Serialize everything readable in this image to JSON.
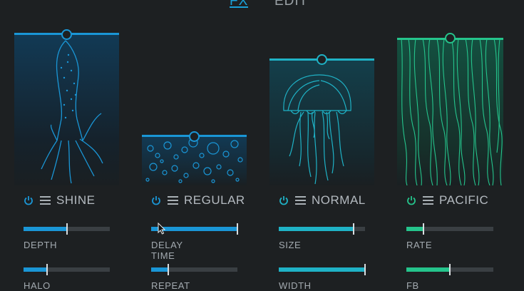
{
  "tabs": [
    {
      "label": "FX",
      "active": true
    },
    {
      "label": "EDIT",
      "active": false
    }
  ],
  "modules": [
    {
      "id": "squid",
      "illustration": "squid-icon",
      "accent": "#1a96d6",
      "preset": "SHINE",
      "params": [
        {
          "label": "DEPTH",
          "value": 0.5
        },
        {
          "label": "HALO",
          "value": 0.27
        }
      ]
    },
    {
      "id": "bubbles",
      "illustration": "bubbles-icon",
      "accent": "#1a96d6",
      "preset": "REGULAR",
      "params": [
        {
          "label": "DELAY TIME",
          "value": 1.0
        },
        {
          "label": "REPEAT",
          "value": 0.2
        }
      ]
    },
    {
      "id": "jellyfish",
      "illustration": "jellyfish-icon",
      "accent": "#1fb2c6",
      "preset": "NORMAL",
      "params": [
        {
          "label": "SIZE",
          "value": 0.87
        },
        {
          "label": "WIDTH",
          "value": 1.0
        }
      ]
    },
    {
      "id": "seaweed",
      "illustration": "seaweed-icon",
      "accent": "#25c48c",
      "preset": "PACIFIC",
      "params": [
        {
          "label": "RATE",
          "value": 0.2
        },
        {
          "label": "FB",
          "value": 0.5
        }
      ]
    }
  ]
}
